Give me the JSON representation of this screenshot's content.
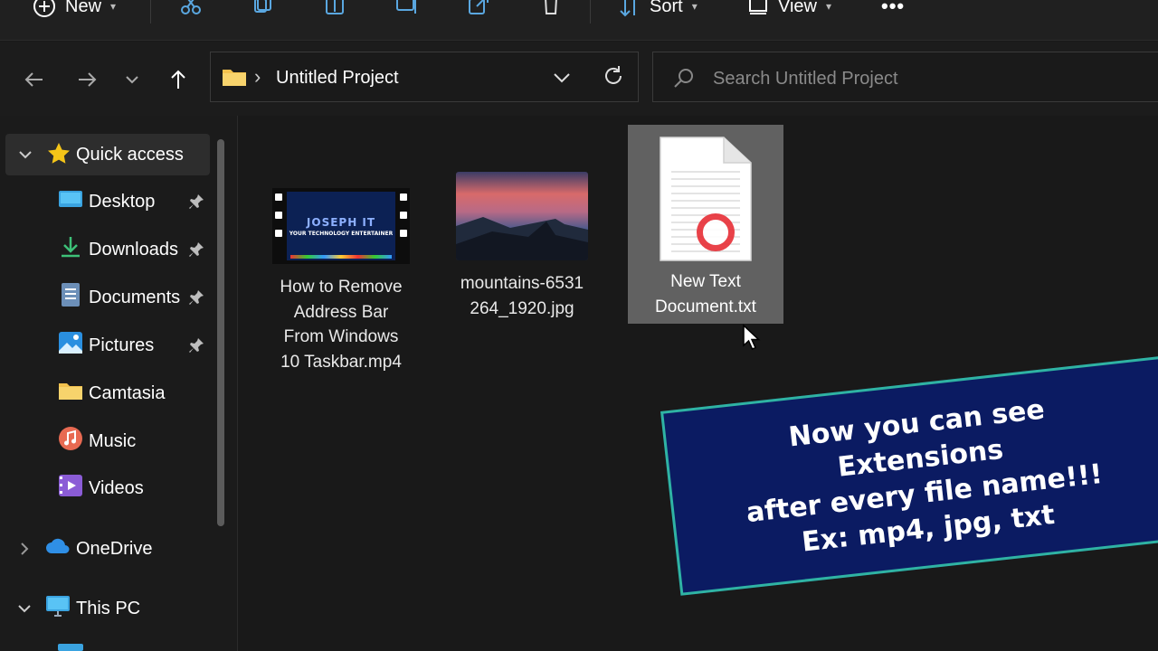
{
  "toolbar": {
    "new_label": "New",
    "sort_label": "Sort",
    "view_label": "View",
    "more_label": "•••"
  },
  "address": {
    "path_label": "Untitled Project",
    "separator": "›"
  },
  "search": {
    "placeholder": "Search Untitled Project"
  },
  "sidebar": {
    "quick_access": "Quick access",
    "items": [
      {
        "label": "Desktop",
        "icon": "desktop-icon",
        "pinned": true
      },
      {
        "label": "Downloads",
        "icon": "downloads-icon",
        "pinned": true
      },
      {
        "label": "Documents",
        "icon": "documents-icon",
        "pinned": true
      },
      {
        "label": "Pictures",
        "icon": "pictures-icon",
        "pinned": true
      },
      {
        "label": "Camtasia",
        "icon": "folder-icon",
        "pinned": false
      },
      {
        "label": "Music",
        "icon": "music-icon",
        "pinned": false
      },
      {
        "label": "Videos",
        "icon": "videos-icon",
        "pinned": false
      }
    ],
    "onedrive": "OneDrive",
    "this_pc": "This PC"
  },
  "files": [
    {
      "name": "How to Remove Address Bar From Windows 10 Taskbar.mp4",
      "type": "video",
      "thumb_title": "JOSEPH IT",
      "thumb_sub": "YOUR TECHNOLOGY ENTERTAINER"
    },
    {
      "name": "mountains-6531 264_1920.jpg",
      "type": "image"
    },
    {
      "name": "New Text Document.txt",
      "type": "text",
      "selected": true
    }
  ],
  "banner": {
    "line1": "Now you can see",
    "line2": "Extensions",
    "line3": "after every file name!!!",
    "line4": "Ex: mp4, jpg, txt"
  },
  "colors": {
    "accent": "#0b1b62",
    "banner_border": "#2fb3a3",
    "selection": "#616161",
    "folder": "#f2c14e"
  }
}
